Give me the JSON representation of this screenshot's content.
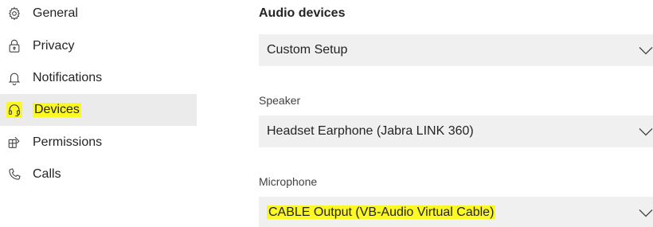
{
  "sidebar": {
    "items": [
      {
        "label": "General",
        "icon": "gear-icon"
      },
      {
        "label": "Privacy",
        "icon": "lock-icon"
      },
      {
        "label": "Notifications",
        "icon": "bell-icon"
      },
      {
        "label": "Devices",
        "icon": "headset-icon",
        "active": true,
        "highlighted": true
      },
      {
        "label": "Permissions",
        "icon": "permissions-icon"
      },
      {
        "label": "Calls",
        "icon": "phone-icon"
      }
    ]
  },
  "audio": {
    "title": "Audio devices",
    "setup_value": "Custom Setup",
    "speaker_label": "Speaker",
    "speaker_value": "Headset Earphone (Jabra LINK 360)",
    "microphone_label": "Microphone",
    "microphone_value": "CABLE Output (VB-Audio Virtual Cable)"
  },
  "colors": {
    "highlight": "#fbf823",
    "active_bg": "#ebebeb",
    "select_bg": "#f0f0f0"
  }
}
